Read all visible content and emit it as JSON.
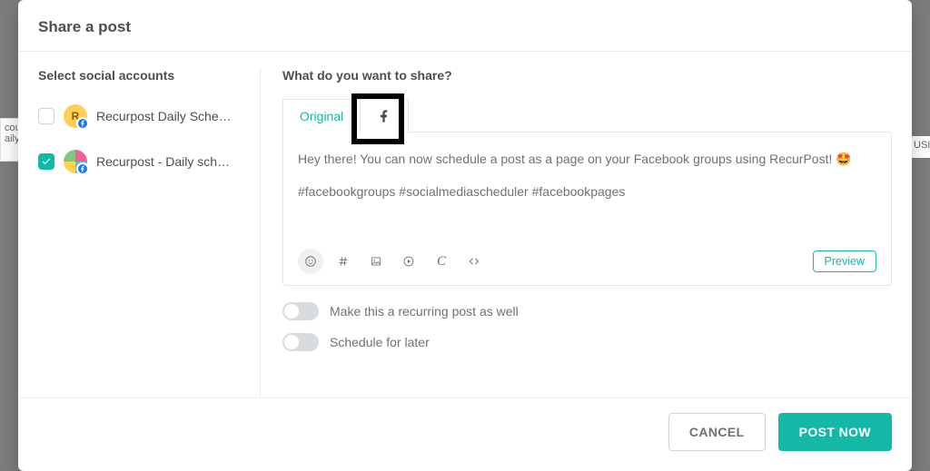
{
  "modal": {
    "title": "Share a post",
    "left": {
      "title": "Select social accounts",
      "accounts": [
        {
          "name": "Recurpost Daily Schedul…",
          "checked": false,
          "avatar_letter": "R"
        },
        {
          "name": "Recurpost - Daily schedu…",
          "checked": true,
          "avatar_letter": ""
        }
      ]
    },
    "right": {
      "title": "What do you want to share?",
      "tabs": {
        "original": "Original",
        "facebook_icon": "facebook-icon"
      },
      "post_body_line1": "Hey there! You can now schedule a post as a page on your Facebook groups using RecurPost! 🤩",
      "post_body_line2": "#facebookgroups #socialmediascheduler #facebookpages",
      "preview_label": "Preview",
      "toggle_recurring": "Make this a recurring post as well",
      "toggle_schedule": "Schedule for later"
    },
    "footer": {
      "cancel": "CANCEL",
      "post_now": "POST NOW"
    }
  },
  "background_fragments": {
    "left_top": "cou",
    "left_mid": "aily",
    "right": "USI"
  }
}
